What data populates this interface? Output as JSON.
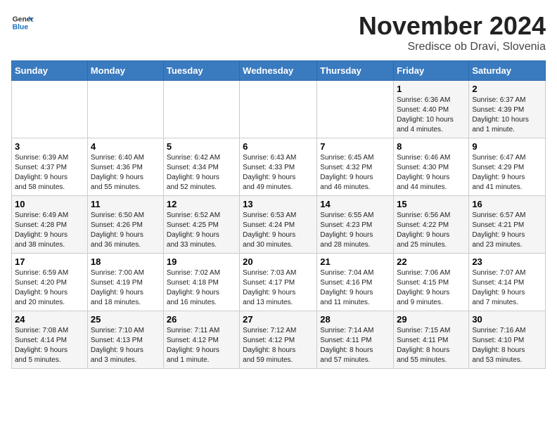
{
  "header": {
    "logo_line1": "General",
    "logo_line2": "Blue",
    "title": "November 2024",
    "subtitle": "Sredisce ob Dravi, Slovenia"
  },
  "weekdays": [
    "Sunday",
    "Monday",
    "Tuesday",
    "Wednesday",
    "Thursday",
    "Friday",
    "Saturday"
  ],
  "weeks": [
    [
      {
        "day": "",
        "info": ""
      },
      {
        "day": "",
        "info": ""
      },
      {
        "day": "",
        "info": ""
      },
      {
        "day": "",
        "info": ""
      },
      {
        "day": "",
        "info": ""
      },
      {
        "day": "1",
        "info": "Sunrise: 6:36 AM\nSunset: 4:40 PM\nDaylight: 10 hours\nand 4 minutes."
      },
      {
        "day": "2",
        "info": "Sunrise: 6:37 AM\nSunset: 4:39 PM\nDaylight: 10 hours\nand 1 minute."
      }
    ],
    [
      {
        "day": "3",
        "info": "Sunrise: 6:39 AM\nSunset: 4:37 PM\nDaylight: 9 hours\nand 58 minutes."
      },
      {
        "day": "4",
        "info": "Sunrise: 6:40 AM\nSunset: 4:36 PM\nDaylight: 9 hours\nand 55 minutes."
      },
      {
        "day": "5",
        "info": "Sunrise: 6:42 AM\nSunset: 4:34 PM\nDaylight: 9 hours\nand 52 minutes."
      },
      {
        "day": "6",
        "info": "Sunrise: 6:43 AM\nSunset: 4:33 PM\nDaylight: 9 hours\nand 49 minutes."
      },
      {
        "day": "7",
        "info": "Sunrise: 6:45 AM\nSunset: 4:32 PM\nDaylight: 9 hours\nand 46 minutes."
      },
      {
        "day": "8",
        "info": "Sunrise: 6:46 AM\nSunset: 4:30 PM\nDaylight: 9 hours\nand 44 minutes."
      },
      {
        "day": "9",
        "info": "Sunrise: 6:47 AM\nSunset: 4:29 PM\nDaylight: 9 hours\nand 41 minutes."
      }
    ],
    [
      {
        "day": "10",
        "info": "Sunrise: 6:49 AM\nSunset: 4:28 PM\nDaylight: 9 hours\nand 38 minutes."
      },
      {
        "day": "11",
        "info": "Sunrise: 6:50 AM\nSunset: 4:26 PM\nDaylight: 9 hours\nand 36 minutes."
      },
      {
        "day": "12",
        "info": "Sunrise: 6:52 AM\nSunset: 4:25 PM\nDaylight: 9 hours\nand 33 minutes."
      },
      {
        "day": "13",
        "info": "Sunrise: 6:53 AM\nSunset: 4:24 PM\nDaylight: 9 hours\nand 30 minutes."
      },
      {
        "day": "14",
        "info": "Sunrise: 6:55 AM\nSunset: 4:23 PM\nDaylight: 9 hours\nand 28 minutes."
      },
      {
        "day": "15",
        "info": "Sunrise: 6:56 AM\nSunset: 4:22 PM\nDaylight: 9 hours\nand 25 minutes."
      },
      {
        "day": "16",
        "info": "Sunrise: 6:57 AM\nSunset: 4:21 PM\nDaylight: 9 hours\nand 23 minutes."
      }
    ],
    [
      {
        "day": "17",
        "info": "Sunrise: 6:59 AM\nSunset: 4:20 PM\nDaylight: 9 hours\nand 20 minutes."
      },
      {
        "day": "18",
        "info": "Sunrise: 7:00 AM\nSunset: 4:19 PM\nDaylight: 9 hours\nand 18 minutes."
      },
      {
        "day": "19",
        "info": "Sunrise: 7:02 AM\nSunset: 4:18 PM\nDaylight: 9 hours\nand 16 minutes."
      },
      {
        "day": "20",
        "info": "Sunrise: 7:03 AM\nSunset: 4:17 PM\nDaylight: 9 hours\nand 13 minutes."
      },
      {
        "day": "21",
        "info": "Sunrise: 7:04 AM\nSunset: 4:16 PM\nDaylight: 9 hours\nand 11 minutes."
      },
      {
        "day": "22",
        "info": "Sunrise: 7:06 AM\nSunset: 4:15 PM\nDaylight: 9 hours\nand 9 minutes."
      },
      {
        "day": "23",
        "info": "Sunrise: 7:07 AM\nSunset: 4:14 PM\nDaylight: 9 hours\nand 7 minutes."
      }
    ],
    [
      {
        "day": "24",
        "info": "Sunrise: 7:08 AM\nSunset: 4:14 PM\nDaylight: 9 hours\nand 5 minutes."
      },
      {
        "day": "25",
        "info": "Sunrise: 7:10 AM\nSunset: 4:13 PM\nDaylight: 9 hours\nand 3 minutes."
      },
      {
        "day": "26",
        "info": "Sunrise: 7:11 AM\nSunset: 4:12 PM\nDaylight: 9 hours\nand 1 minute."
      },
      {
        "day": "27",
        "info": "Sunrise: 7:12 AM\nSunset: 4:12 PM\nDaylight: 8 hours\nand 59 minutes."
      },
      {
        "day": "28",
        "info": "Sunrise: 7:14 AM\nSunset: 4:11 PM\nDaylight: 8 hours\nand 57 minutes."
      },
      {
        "day": "29",
        "info": "Sunrise: 7:15 AM\nSunset: 4:11 PM\nDaylight: 8 hours\nand 55 minutes."
      },
      {
        "day": "30",
        "info": "Sunrise: 7:16 AM\nSunset: 4:10 PM\nDaylight: 8 hours\nand 53 minutes."
      }
    ]
  ]
}
